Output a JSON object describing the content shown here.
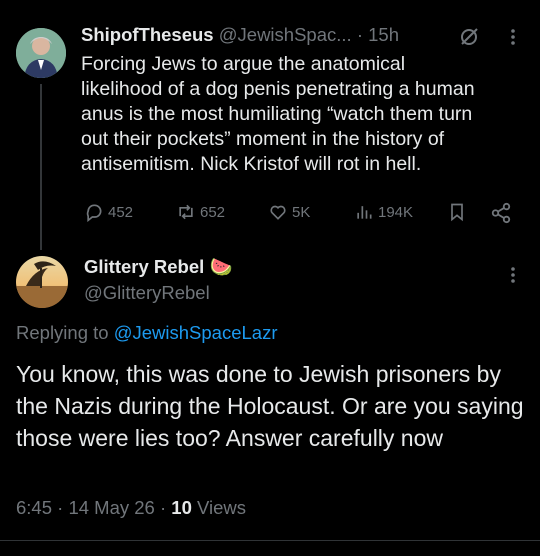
{
  "parent": {
    "display_name": "ShipofTheseus",
    "handle": "@JewishSpac...",
    "time": "15h",
    "text_lines": [
      "Forcing Jews to argue the anatomical",
      "likelihood of a dog penis penetrating a human",
      "anus is the most humiliating “watch them turn",
      "out their pockets” moment in the history of",
      "antisemitism. Nick Kristof will rot in hell."
    ],
    "stats": {
      "replies": "452",
      "reposts": "652",
      "likes": "5K",
      "views": "194K"
    }
  },
  "reply": {
    "display_name": "Glittery Rebel",
    "emoji": "🍉",
    "handle": "@GlitteryRebel",
    "replying_prefix": "Replying to",
    "replying_to": "@JewishSpaceLazr",
    "text": "You know, this was done to Jewish prisoners by the Nazis during the Holocaust. Or are you saying those were lies too? Answer carefully now",
    "time": "6:45 · 14 May 26 ·",
    "views_count": "10",
    "views_label": "Views"
  },
  "icons": [
    "reply-icon",
    "repost-icon",
    "like-icon",
    "views-icon",
    "bookmark-icon",
    "share-icon",
    "grok-icon",
    "more-icon"
  ],
  "colors": {
    "background": "#000000",
    "text": "#e7e9ea",
    "muted": "#71767b",
    "link": "#1d9bf0"
  }
}
